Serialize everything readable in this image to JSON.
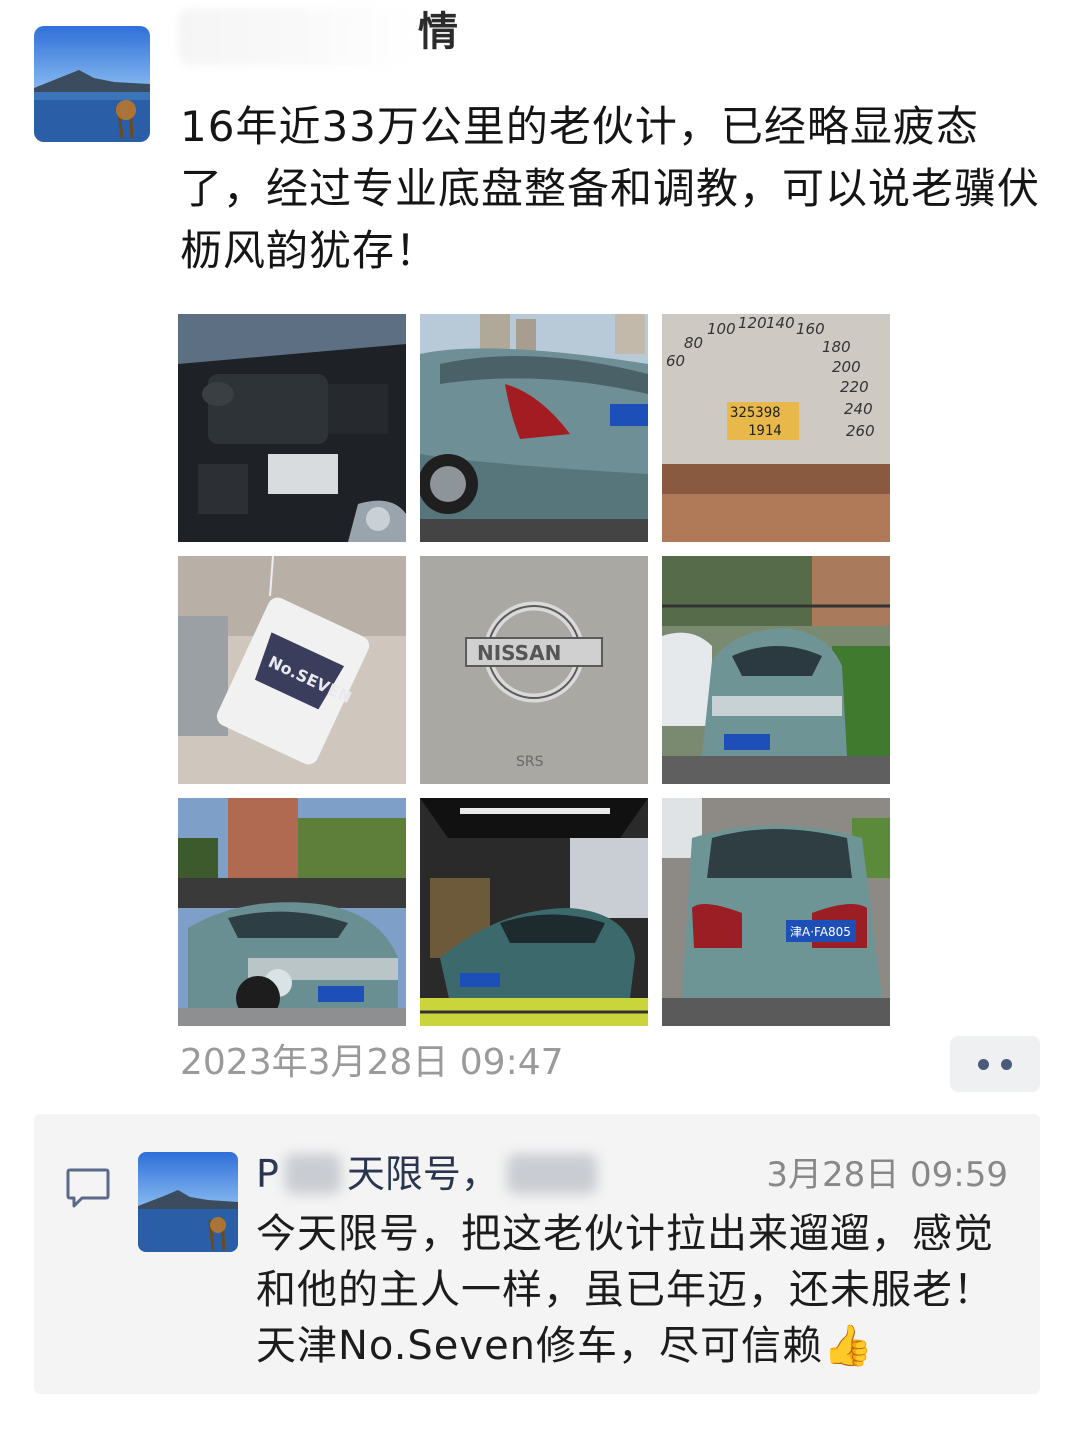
{
  "post": {
    "author_visible": "‎情",
    "text": "16年近33万公里的老伙计，已经略显疲态了，经过专业底盘整备和调教，可以说老骥伏枥风韵犹存！",
    "timestamp": "2023年3月28日 09:47",
    "photos": [
      {
        "name": "engine-bay-photo"
      },
      {
        "name": "car-rear-photo"
      },
      {
        "name": "odometer-photo",
        "odometer": "325398",
        "trip": "1914"
      },
      {
        "name": "air-freshener-photo",
        "tag_text": "No.SEVEN"
      },
      {
        "name": "nissan-logo-photo",
        "brand": "NISSAN",
        "srs": "SRS"
      },
      {
        "name": "car-front-parked-photo"
      },
      {
        "name": "car-front-garden-photo"
      },
      {
        "name": "car-workshop-photo"
      },
      {
        "name": "car-rear-plate-photo",
        "plate": "津A·FA805"
      }
    ]
  },
  "more_button": {
    "icon": "more-dots-icon"
  },
  "comment": {
    "name_visible": "天限号，",
    "name_prefix": "P",
    "time": "3月28日 09:59",
    "text": "今天限号，把这老伙计拉出来遛遛，感觉和他的主人一样，虽已年迈，还未服老！天津No.Seven修车，尽可信赖👍"
  },
  "colors": {
    "link_name": "#2a3650",
    "timestamp": "#9a9a9a",
    "comment_bg": "#f4f4f4"
  }
}
